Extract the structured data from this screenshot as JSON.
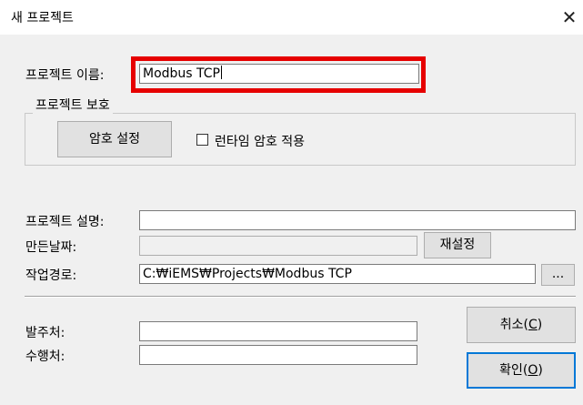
{
  "window": {
    "title": "새 프로젝트",
    "close_glyph": "✕"
  },
  "project_name": {
    "label": "프로젝트 이름:",
    "value": "Modbus TCP"
  },
  "protection": {
    "group_label": "프로젝트 보호",
    "password_button": "암호 설정",
    "runtime_checkbox_label": "런타임 암호 적용",
    "runtime_checked": false
  },
  "description": {
    "label": "프로젝트 설명:",
    "value": ""
  },
  "created_date": {
    "label": "만든날짜:",
    "value": "",
    "reset_button": "재설정"
  },
  "work_path": {
    "label": "작업경로:",
    "value": "C:₩iEMS₩Projects₩Modbus TCP",
    "browse_button": "..."
  },
  "client": {
    "label": "발주처:",
    "value": ""
  },
  "contractor": {
    "label": "수행처:",
    "value": ""
  },
  "buttons": {
    "cancel_text": "취소(",
    "cancel_key": "C",
    "cancel_end": ")",
    "ok_text": "확인(",
    "ok_key": "O",
    "ok_end": ")"
  },
  "colors": {
    "highlight": "#e60000",
    "dialog_bg": "#f0f0f0",
    "default_button_border": "#0078d7"
  }
}
